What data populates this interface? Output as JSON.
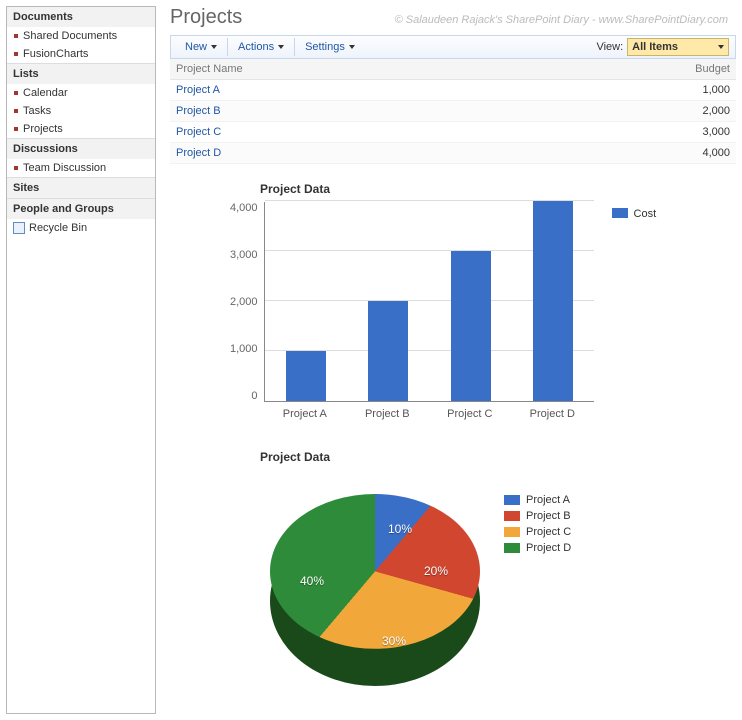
{
  "leftnav": {
    "sections": [
      {
        "title": "Documents",
        "items": [
          "Shared Documents",
          "FusionCharts"
        ]
      },
      {
        "title": "Lists",
        "items": [
          "Calendar",
          "Tasks",
          "Projects"
        ]
      },
      {
        "title": "Discussions",
        "items": [
          "Team Discussion"
        ]
      },
      {
        "title": "Sites",
        "items": []
      },
      {
        "title": "People and Groups",
        "items": []
      }
    ],
    "recycle": "Recycle Bin"
  },
  "page_title": "Projects",
  "watermark": "© Salaudeen Rajack's SharePoint Diary - www.SharePointDiary.com",
  "toolbar": {
    "new": "New",
    "actions": "Actions",
    "settings": "Settings",
    "view_label": "View:",
    "view_value": "All Items"
  },
  "list": {
    "columns": [
      "Project Name",
      "Budget"
    ],
    "rows": [
      {
        "name": "Project A",
        "budget": "1,000"
      },
      {
        "name": "Project B",
        "budget": "2,000"
      },
      {
        "name": "Project C",
        "budget": "3,000"
      },
      {
        "name": "Project D",
        "budget": "4,000"
      }
    ]
  },
  "chart_data": [
    {
      "type": "bar",
      "title": "Project Data",
      "categories": [
        "Project A",
        "Project B",
        "Project C",
        "Project D"
      ],
      "values": [
        1000,
        2000,
        3000,
        4000
      ],
      "legend": [
        "Cost"
      ],
      "ylim": [
        0,
        4000
      ],
      "yticks": [
        "0",
        "1,000",
        "2,000",
        "3,000",
        "4,000"
      ],
      "colors": {
        "bar": "#3a6fc7"
      }
    },
    {
      "type": "pie",
      "title": "Project Data",
      "series": [
        {
          "name": "Project A",
          "pct": 10,
          "label": "10%",
          "color": "#3a6fc7"
        },
        {
          "name": "Project B",
          "pct": 20,
          "label": "20%",
          "color": "#d1462f"
        },
        {
          "name": "Project C",
          "pct": 30,
          "label": "30%",
          "color": "#f2a73a"
        },
        {
          "name": "Project D",
          "pct": 40,
          "label": "40%",
          "color": "#2e8b3a"
        }
      ]
    }
  ]
}
